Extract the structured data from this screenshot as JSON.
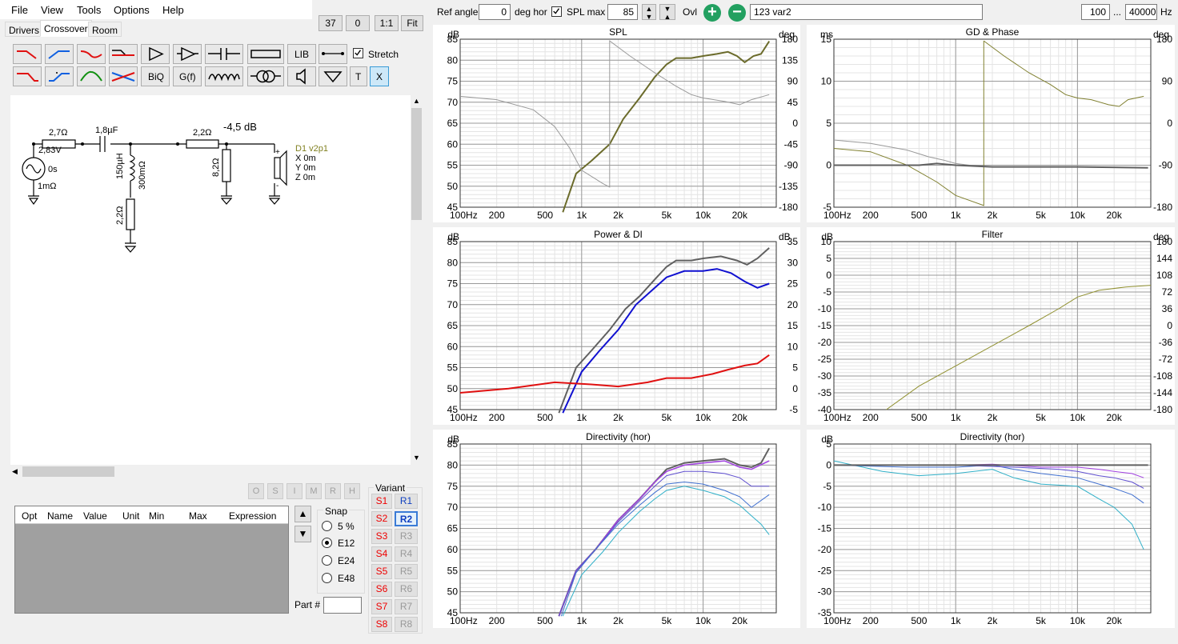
{
  "menu": [
    "File",
    "View",
    "Tools",
    "Options",
    "Help"
  ],
  "topbuttons": {
    "b37": "37",
    "b0": "0",
    "b11": "1:1",
    "fit": "Fit"
  },
  "tabs": [
    "Drivers",
    "Crossover",
    "Room"
  ],
  "stretch_label": "Stretch",
  "tool_labels": {
    "lib": "LIB",
    "biq": "BiQ",
    "gf": "G(f)",
    "t": "T",
    "x": "X"
  },
  "schematic": {
    "r1": "2,7Ω",
    "c1": "1,8µF",
    "r2": "2,2Ω",
    "att": "-4,5 dB",
    "src_v": "2,83V",
    "src_t": "0s",
    "src_r": "1mΩ",
    "l1": "150µH",
    "l1r": "300mΩ",
    "r3": "2,2Ω",
    "r4": "8,2Ω",
    "drv": "D1 v2p1",
    "x": "X 0m",
    "y": "Y 0m",
    "z": "Z 0m",
    "plus": "+",
    "minus": "-"
  },
  "optimizer_buttons": [
    "O",
    "S",
    "I",
    "M",
    "R",
    "H"
  ],
  "variant": {
    "title": "Variant",
    "s": [
      "S1",
      "S2",
      "S3",
      "S4",
      "S5",
      "S6",
      "S7",
      "S8"
    ],
    "r": [
      "R1",
      "R2",
      "R3",
      "R4",
      "R5",
      "R6",
      "R7",
      "R8"
    ]
  },
  "table_headers": [
    "Opt",
    "Name",
    "Value",
    "Unit",
    "Min",
    "Max",
    "Expression"
  ],
  "snap": {
    "title": "Snap",
    "options": [
      "5 %",
      "E12",
      "E24",
      "E48"
    ],
    "selected": "E12"
  },
  "part_label": "Part #",
  "toolbar": {
    "ref_angle_label": "Ref angle",
    "ref_angle": "0",
    "deg_hor": "deg hor",
    "spl_max_label": "SPL max",
    "spl_max": "85",
    "ovl": "Ovl",
    "name": "123 var2",
    "fmin": "100",
    "dots": "...",
    "fmax": "40000",
    "hz": "Hz"
  },
  "colors": {
    "olive": "#6b6b2b",
    "blue": "#1010d0",
    "red": "#e01010",
    "gray": "#606060",
    "cyan": "#30b0c8",
    "purple": "#8040d0"
  },
  "charts": [
    {
      "title": "SPL",
      "yl": "dB",
      "yr": "deg",
      "left": [
        "85",
        "80",
        "75",
        "70",
        "65",
        "60",
        "55",
        "50",
        "45"
      ],
      "right": [
        "180",
        "135",
        "90",
        "45",
        "0",
        "-45",
        "-90",
        "-135",
        "-180"
      ],
      "x": [
        "100Hz",
        "200",
        "500",
        "1k",
        "2k",
        "5k",
        "10k",
        "20k"
      ]
    },
    {
      "title": "GD & Phase",
      "yl": "ms",
      "yr": "deg",
      "left": [
        "15",
        "10",
        "5",
        "0",
        "-5"
      ],
      "right": [
        "180",
        "90",
        "0",
        "-90",
        "-180"
      ],
      "x": [
        "100Hz",
        "200",
        "500",
        "1k",
        "2k",
        "5k",
        "10k",
        "20k"
      ]
    },
    {
      "title": "Power & DI",
      "yl": "dB",
      "yr": "dB",
      "left": [
        "85",
        "80",
        "75",
        "70",
        "65",
        "60",
        "55",
        "50",
        "45"
      ],
      "right": [
        "35",
        "30",
        "25",
        "20",
        "15",
        "10",
        "5",
        "0",
        "-5"
      ],
      "x": [
        "100Hz",
        "200",
        "500",
        "1k",
        "2k",
        "5k",
        "10k",
        "20k"
      ]
    },
    {
      "title": "Filter",
      "yl": "dB",
      "yr": "deg",
      "left": [
        "10",
        "5",
        "0",
        "-5",
        "-10",
        "-15",
        "-20",
        "-25",
        "-30",
        "-35",
        "-40"
      ],
      "right": [
        "180",
        "144",
        "108",
        "72",
        "36",
        "0",
        "-36",
        "-72",
        "-108",
        "-144",
        "-180"
      ],
      "x": [
        "100Hz",
        "200",
        "500",
        "1k",
        "2k",
        "5k",
        "10k",
        "20k"
      ]
    },
    {
      "title": "Directivity (hor)",
      "yl": "dB",
      "yr": "",
      "left": [
        "85",
        "80",
        "75",
        "70",
        "65",
        "60",
        "55",
        "50",
        "45"
      ],
      "right": [],
      "x": [
        "100Hz",
        "200",
        "500",
        "1k",
        "2k",
        "5k",
        "10k",
        "20k"
      ]
    },
    {
      "title": "Directivity (hor)",
      "yl": "dB",
      "yr": "",
      "left": [
        "5",
        "0",
        "-5",
        "-10",
        "-15",
        "-20",
        "-25",
        "-30",
        "-35"
      ],
      "right": [],
      "x": [
        "100Hz",
        "200",
        "500",
        "1k",
        "2k",
        "5k",
        "10k",
        "20k"
      ]
    }
  ]
}
